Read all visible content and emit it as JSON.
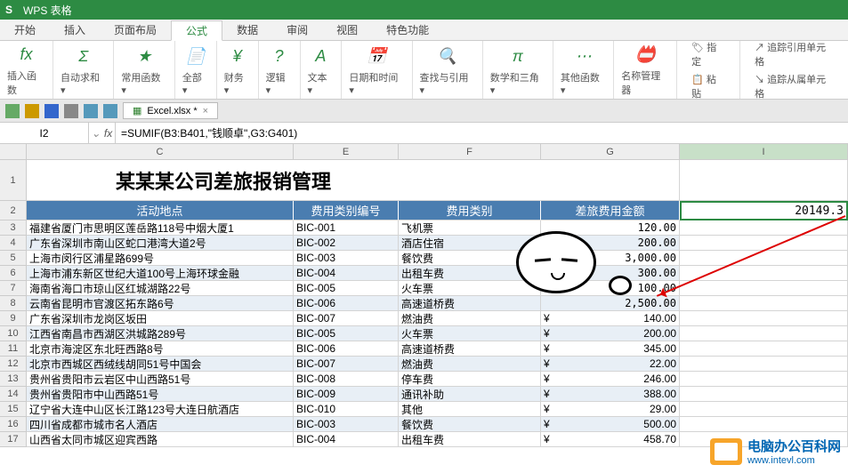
{
  "app": {
    "name": "WPS 表格"
  },
  "menu": [
    "开始",
    "插入",
    "页面布局",
    "公式",
    "数据",
    "审阅",
    "视图",
    "特色功能"
  ],
  "menu_active": 3,
  "ribbon": {
    "groups": [
      {
        "icon": "fx",
        "label": "插入函数"
      },
      {
        "icon": "Σ",
        "label": "自动求和 ▾"
      },
      {
        "icon": "★",
        "label": "常用函数 ▾"
      },
      {
        "icon": "📄",
        "label": "全部 ▾"
      },
      {
        "icon": "¥",
        "label": "财务 ▾"
      },
      {
        "icon": "?",
        "label": "逻辑 ▾"
      },
      {
        "icon": "A",
        "label": "文本 ▾"
      },
      {
        "icon": "📅",
        "label": "日期和时间 ▾"
      },
      {
        "icon": "🔍",
        "label": "查找与引用 ▾"
      },
      {
        "icon": "π",
        "label": "数学和三角 ▾"
      },
      {
        "icon": "⋯",
        "label": "其他函数 ▾"
      }
    ],
    "right": [
      {
        "icon": "📛",
        "label": "名称管理器"
      },
      {
        "icon": "🏷",
        "label": "指定"
      },
      {
        "icon": "📋",
        "label": "粘贴"
      },
      {
        "label": "追踪引用单元格"
      },
      {
        "label": "追踪从属单元格"
      }
    ]
  },
  "doctab": "Excel.xlsx *",
  "formula": {
    "cellref": "I2",
    "text": "=SUMIF(B3:B401,\"钱顺卓\",G3:G401)"
  },
  "cols": [
    "C",
    "E",
    "F",
    "G",
    "I"
  ],
  "title_row": "某某某公司差旅报销管理",
  "headers": {
    "C": "活动地点",
    "E": "费用类别编号",
    "F": "费用类别",
    "G": "差旅费用金额",
    "I": "20149.3"
  },
  "rows": [
    {
      "n": 3,
      "C": "福建省厦门市思明区莲岳路118号中烟大厦1",
      "E": "BIC-001",
      "F": "飞机票",
      "G": "120.00",
      "cny": false
    },
    {
      "n": 4,
      "C": "广东省深圳市南山区蛇口港湾大道2号",
      "E": "BIC-002",
      "F": "酒店住宿",
      "G": "200.00",
      "cny": false
    },
    {
      "n": 5,
      "C": "上海市闵行区浦星路699号",
      "E": "BIC-003",
      "F": "餐饮费",
      "G": "3,000.00",
      "cny": false
    },
    {
      "n": 6,
      "C": "上海市浦东新区世纪大道100号上海环球金融",
      "E": "BIC-004",
      "F": "出租车费",
      "G": "300.00",
      "cny": false
    },
    {
      "n": 7,
      "C": "海南省海口市琼山区红城湖路22号",
      "E": "BIC-005",
      "F": "火车票",
      "G": "100.00",
      "cny": false
    },
    {
      "n": 8,
      "C": "云南省昆明市官渡区拓东路6号",
      "E": "BIC-006",
      "F": "高速道桥费",
      "G": "2,500.00",
      "cny": false
    },
    {
      "n": 9,
      "C": "广东省深圳市龙岗区坂田",
      "E": "BIC-007",
      "F": "燃油费",
      "G": "140.00",
      "cny": true
    },
    {
      "n": 10,
      "C": "江西省南昌市西湖区洪城路289号",
      "E": "BIC-005",
      "F": "火车票",
      "G": "200.00",
      "cny": true
    },
    {
      "n": 11,
      "C": "北京市海淀区东北旺西路8号",
      "E": "BIC-006",
      "F": "高速道桥费",
      "G": "345.00",
      "cny": true
    },
    {
      "n": 12,
      "C": "北京市西城区西绒线胡同51号中国会",
      "E": "BIC-007",
      "F": "燃油费",
      "G": "22.00",
      "cny": true
    },
    {
      "n": 13,
      "C": "贵州省贵阳市云岩区中山西路51号",
      "E": "BIC-008",
      "F": "停车费",
      "G": "246.00",
      "cny": true
    },
    {
      "n": 14,
      "C": "贵州省贵阳市中山西路51号",
      "E": "BIC-009",
      "F": "通讯补助",
      "G": "388.00",
      "cny": true
    },
    {
      "n": 15,
      "C": "辽宁省大连中山区长江路123号大连日航酒店",
      "E": "BIC-010",
      "F": "其他",
      "G": "29.00",
      "cny": true
    },
    {
      "n": 16,
      "C": "四川省成都市城市名人酒店",
      "E": "BIC-003",
      "F": "餐饮费",
      "G": "500.00",
      "cny": true
    },
    {
      "n": 17,
      "C": "山西省太同市城区迎宾西路",
      "E": "BIC-004",
      "F": "出租车费",
      "G": "458.70",
      "cny": true
    }
  ],
  "watermark": {
    "t1": "电脑办公百科网",
    "t2": "www.intevl.com"
  }
}
